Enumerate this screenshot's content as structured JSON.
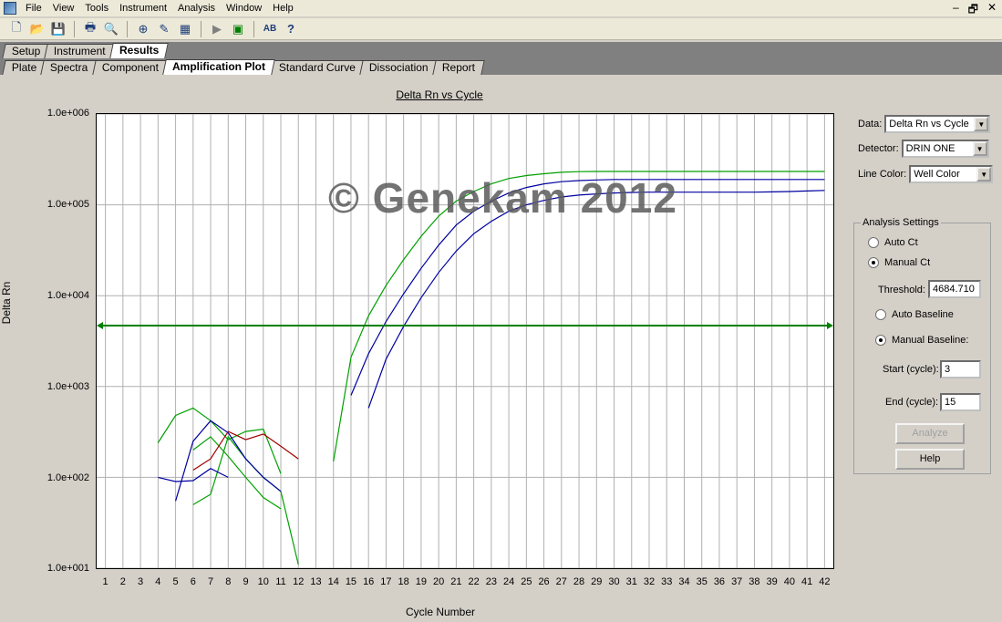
{
  "menu": [
    "File",
    "View",
    "Tools",
    "Instrument",
    "Analysis",
    "Window",
    "Help"
  ],
  "window_controls": [
    "–",
    "🗗",
    "✕"
  ],
  "toolbar_icons": [
    "new-file-icon",
    "open-folder-icon",
    "save-icon",
    "print-icon",
    "print-preview-icon",
    "zoom-icon",
    "edit-icon",
    "grid-icon",
    "run-icon",
    "run-step-icon",
    "spell-icon",
    "help-icon"
  ],
  "tabs_top": [
    {
      "label": "Setup",
      "active": false
    },
    {
      "label": "Instrument",
      "active": false
    },
    {
      "label": "Results",
      "active": true
    }
  ],
  "tabs_sub": [
    {
      "label": "Plate",
      "active": false
    },
    {
      "label": "Spectra",
      "active": false
    },
    {
      "label": "Component",
      "active": false
    },
    {
      "label": "Amplification Plot",
      "active": true
    },
    {
      "label": "Standard Curve",
      "active": false
    },
    {
      "label": "Dissociation",
      "active": false
    },
    {
      "label": "Report",
      "active": false
    }
  ],
  "plot": {
    "title": "Delta Rn vs Cycle",
    "ylabel": "Delta Rn",
    "xlabel": "Cycle Number",
    "watermark": "© Genekam 2012",
    "ytick_labels": [
      "1.0e+006",
      "1.0e+005",
      "1.0e+004",
      "1.0e+003",
      "1.0e+002",
      "1.0e+001"
    ]
  },
  "chart_data": {
    "type": "line",
    "title": "Delta Rn vs Cycle",
    "xlabel": "Cycle Number",
    "ylabel": "Delta Rn",
    "yscale": "log",
    "ylim": [
      10,
      1000000
    ],
    "xlim": [
      0.5,
      42.5
    ],
    "x_ticks": [
      1,
      2,
      3,
      4,
      5,
      6,
      7,
      8,
      9,
      10,
      11,
      12,
      13,
      14,
      15,
      16,
      17,
      18,
      19,
      20,
      21,
      22,
      23,
      24,
      25,
      26,
      27,
      28,
      29,
      30,
      31,
      32,
      33,
      34,
      35,
      36,
      37,
      38,
      39,
      40,
      41,
      42
    ],
    "grid": true,
    "threshold": 4684.71,
    "series": [
      {
        "color": "#00a000",
        "x": [
          14,
          15,
          16,
          17,
          18,
          19,
          20,
          21,
          22,
          23,
          24,
          25,
          26,
          27,
          28,
          29,
          30,
          31,
          32,
          33,
          34,
          35,
          36,
          37,
          38,
          39,
          40,
          41,
          42
        ],
        "y": [
          150,
          2100,
          6000,
          13000,
          25000,
          45000,
          75000,
          110000,
          140000,
          170000,
          195000,
          210000,
          220000,
          228000,
          232000,
          233000,
          233000,
          233000,
          233000,
          233000,
          233000,
          233000,
          233000,
          233000,
          233000,
          233000,
          233000,
          233000,
          233000
        ]
      },
      {
        "color": "#0000a0",
        "x": [
          15,
          16,
          17,
          18,
          19,
          20,
          21,
          22,
          23,
          24,
          25,
          26,
          27,
          28,
          29,
          30,
          31,
          32,
          33,
          34,
          35,
          36,
          37,
          38,
          39,
          40,
          41,
          42
        ],
        "y": [
          800,
          2300,
          5200,
          10500,
          20000,
          36000,
          60000,
          85000,
          110000,
          135000,
          155000,
          170000,
          180000,
          185000,
          188000,
          190000,
          190000,
          190000,
          190000,
          190000,
          190000,
          190000,
          190000,
          190000,
          190000,
          190000,
          190000,
          190000
        ]
      },
      {
        "color": "#0000a0",
        "x": [
          16,
          17,
          18,
          19,
          20,
          21,
          22,
          23,
          24,
          25,
          26,
          27,
          28,
          29,
          30,
          31,
          32,
          33,
          34,
          35,
          36,
          37,
          38,
          39,
          40,
          41,
          42
        ],
        "y": [
          580,
          2000,
          4600,
          9500,
          18000,
          31000,
          48000,
          66000,
          85000,
          100000,
          112000,
          122000,
          128000,
          132000,
          135000,
          137000,
          138000,
          138000,
          138000,
          138000,
          138000,
          138000,
          138000,
          139000,
          140000,
          142000,
          144000
        ]
      },
      {
        "color": "#00a000",
        "x": [
          4,
          5,
          6,
          7,
          8,
          9,
          10,
          11
        ],
        "y": [
          240,
          480,
          580,
          420,
          260,
          320,
          340,
          110
        ]
      },
      {
        "color": "#00a000",
        "x": [
          6,
          7,
          8,
          9,
          10,
          11,
          12
        ],
        "y": [
          50,
          65,
          280,
          160,
          100,
          70,
          11
        ]
      },
      {
        "color": "#00a000",
        "x": [
          6,
          7,
          8,
          9,
          10,
          11
        ],
        "y": [
          200,
          280,
          170,
          100,
          60,
          45
        ]
      },
      {
        "color": "#0000a0",
        "x": [
          4,
          5,
          6,
          7,
          8
        ],
        "y": [
          100,
          90,
          92,
          125,
          100
        ]
      },
      {
        "color": "#0000a0",
        "x": [
          5,
          6,
          7,
          8,
          9,
          10,
          11
        ],
        "y": [
          55,
          250,
          420,
          310,
          160,
          100,
          70
        ]
      },
      {
        "color": "#a00000",
        "x": [
          6,
          7,
          8,
          9,
          10,
          11,
          12
        ],
        "y": [
          120,
          160,
          320,
          260,
          300,
          220,
          160
        ]
      }
    ]
  },
  "side": {
    "data_label": "Data:",
    "data_value": "Delta Rn vs Cycle",
    "detector_label": "Detector:",
    "detector_value": "DRIN ONE",
    "linecolor_label": "Line Color:",
    "linecolor_value": "Well Color",
    "group_title": "Analysis Settings",
    "auto_ct": "Auto Ct",
    "manual_ct": "Manual Ct",
    "threshold_label": "Threshold:",
    "threshold_value": "4684.710",
    "auto_baseline": "Auto Baseline",
    "manual_baseline": "Manual Baseline:",
    "start_label": "Start (cycle):",
    "start_value": "3",
    "end_label": "End (cycle):",
    "end_value": "15",
    "analyze_button": "Analyze",
    "help_button": "Help"
  }
}
